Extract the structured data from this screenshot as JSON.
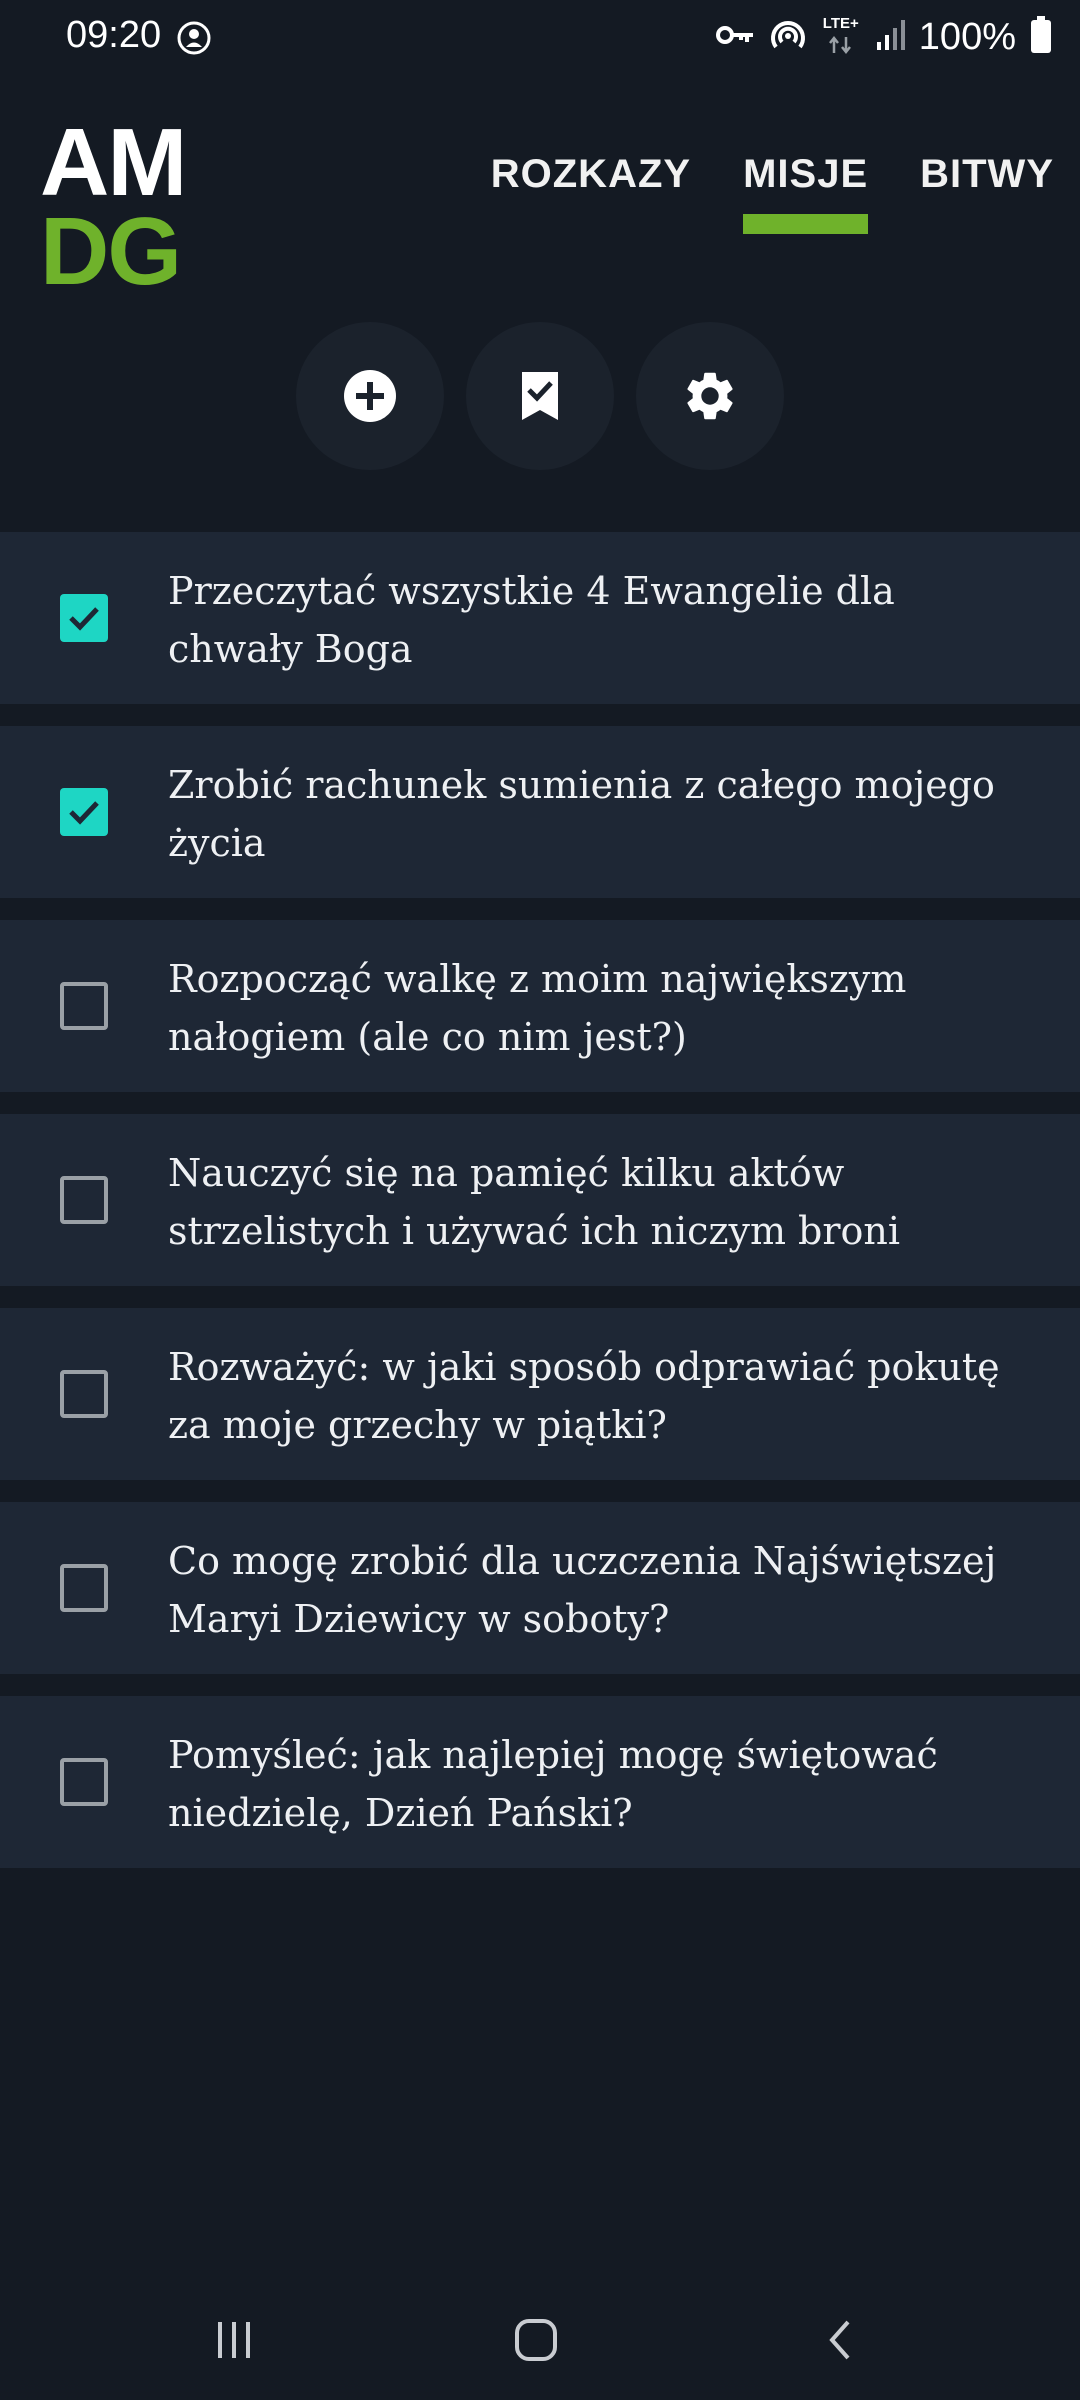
{
  "status_bar": {
    "time": "09:20",
    "network": "LTE+",
    "battery": "100%",
    "icons": [
      "key-icon",
      "hotspot-icon",
      "lte-icon",
      "signal-icon",
      "battery-icon"
    ]
  },
  "logo": {
    "line1": "AM",
    "line2": "DG",
    "accent_color": "#6fb22b"
  },
  "tabs": [
    {
      "label": "ROZKAZY",
      "active": false
    },
    {
      "label": "MISJE",
      "active": true
    },
    {
      "label": "BITWY",
      "active": false
    }
  ],
  "actions": [
    {
      "name": "add",
      "icon": "plus-circle-icon"
    },
    {
      "name": "bookmark",
      "icon": "bookmark-check-icon"
    },
    {
      "name": "settings",
      "icon": "gear-icon"
    }
  ],
  "missions": [
    {
      "text": "Przeczytać wszystkie 4 Ewangelie dla chwały Boga",
      "checked": true
    },
    {
      "text": "Zrobić rachunek sumienia z całego mojego życia",
      "checked": true
    },
    {
      "text": "Rozpocząć walkę z moim największym nałogiem (ale co nim jest?)",
      "checked": false
    },
    {
      "text": "Nauczyć się na pamięć kilku aktów strzelistych i używać ich niczym broni",
      "checked": false
    },
    {
      "text": "Rozważyć: w jaki sposób odprawiać pokutę za moje grzechy w piątki?",
      "checked": false
    },
    {
      "text": "Co mogę zrobić dla uczczenia Najświętszej Maryi Dziewicy w soboty?",
      "checked": false
    },
    {
      "text": "Pomyśleć: jak najlepiej mogę świętować niedzielę, Dzień Pański?",
      "checked": false
    }
  ],
  "colors": {
    "background": "#141a23",
    "row": "#1e2735",
    "checkbox_checked": "#1ed6c4",
    "accent": "#6fb22b"
  }
}
